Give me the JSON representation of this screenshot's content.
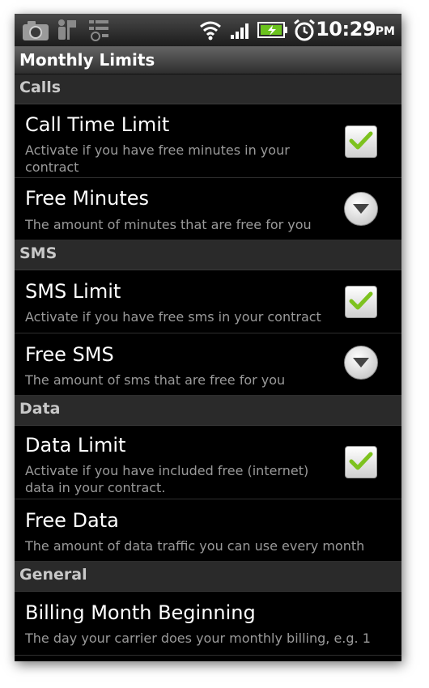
{
  "status_bar": {
    "time": "10:29",
    "ampm": "PM",
    "icons": [
      "camera-icon",
      "usb-debug-icon",
      "notification-icon",
      "wifi-icon",
      "signal-icon",
      "battery-charging-icon",
      "alarm-clock-icon"
    ]
  },
  "title": "Monthly Limits",
  "sections": {
    "calls": {
      "header": "Calls",
      "call_time_limit": {
        "title": "Call Time Limit",
        "subtitle": "Activate if you have free minutes in your contract",
        "checked": true
      },
      "free_minutes": {
        "title": "Free Minutes",
        "subtitle": "The amount of minutes that are free for you"
      }
    },
    "sms": {
      "header": "SMS",
      "sms_limit": {
        "title": "SMS Limit",
        "subtitle": "Activate if you have free sms in your contract",
        "checked": true
      },
      "free_sms": {
        "title": "Free SMS",
        "subtitle": "The amount of sms that are free for you"
      }
    },
    "data": {
      "header": "Data",
      "data_limit": {
        "title": "Data Limit",
        "subtitle": "Activate if you have included free (internet) data in your contract.",
        "checked": true
      },
      "free_data": {
        "title": "Free Data",
        "subtitle": "The amount of data traffic you can use every month"
      }
    },
    "general": {
      "header": "General",
      "billing_month_beginning": {
        "title": "Billing Month Beginning",
        "subtitle": "The day your carrier does your monthly billing, e.g. 1"
      }
    }
  },
  "colors": {
    "background": "#000000",
    "section_header_bg": "#2a2a2a",
    "check_green": "#7dc21e",
    "subtitle_text": "#9a9a9a"
  }
}
